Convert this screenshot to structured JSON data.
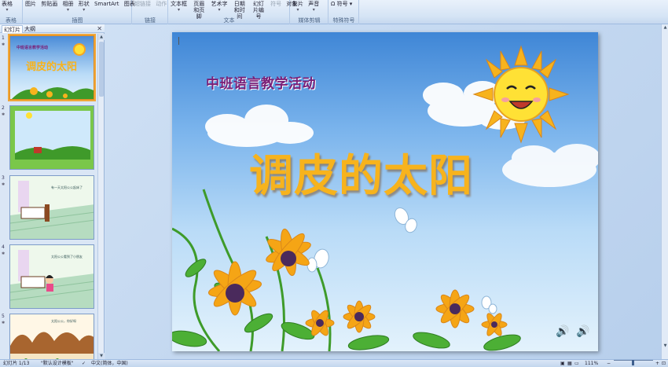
{
  "ribbon": {
    "groups": [
      {
        "id": "tables",
        "label": "表格",
        "items": [
          {
            "label": "表格",
            "disabled": false
          }
        ]
      },
      {
        "id": "illustrations",
        "label": "插图",
        "items": [
          {
            "label": "图片",
            "disabled": false
          },
          {
            "label": "剪贴画",
            "disabled": false
          },
          {
            "label": "相册",
            "disabled": false
          },
          {
            "label": "形状",
            "disabled": false
          },
          {
            "label": "SmartArt",
            "disabled": false
          },
          {
            "label": "图表",
            "disabled": false
          }
        ]
      },
      {
        "id": "links",
        "label": "链接",
        "items": [
          {
            "label": "超链接",
            "disabled": true
          },
          {
            "label": "动作",
            "disabled": true
          }
        ]
      },
      {
        "id": "text",
        "label": "文本",
        "items": [
          {
            "label": "文本框",
            "disabled": false
          },
          {
            "label": "页眉和页脚",
            "disabled": false
          },
          {
            "label": "艺术字",
            "disabled": false
          },
          {
            "label": "日期和时间",
            "disabled": false
          },
          {
            "label": "幻灯片编号",
            "disabled": false
          },
          {
            "label": "符号",
            "disabled": true
          },
          {
            "label": "对象",
            "disabled": false
          }
        ]
      },
      {
        "id": "media",
        "label": "媒体剪辑",
        "items": [
          {
            "label": "影片",
            "disabled": false
          },
          {
            "label": "声音",
            "disabled": false
          }
        ]
      },
      {
        "id": "special",
        "label": "特殊符号",
        "items": [
          {
            "label": "符号",
            "disabled": false
          }
        ]
      }
    ]
  },
  "pane": {
    "tabs": [
      "幻灯片",
      "大纲"
    ],
    "active_tab": 0,
    "close_glyph": "✕",
    "thumbnails": [
      {
        "number": "1",
        "title": "调皮的太阳",
        "subtitle": "中班语言教学活动"
      },
      {
        "number": "2"
      },
      {
        "number": "3",
        "caption": "有一天太阳公公起床了"
      },
      {
        "number": "4",
        "caption": "太阳公公看到了小朋友"
      },
      {
        "number": "5",
        "caption": "太阳公公，你好呀"
      }
    ],
    "selected_index": 0
  },
  "slide": {
    "subtitle": "中班语言教学活动",
    "title": "调皮的太阳",
    "speaker_glyph": "🔊"
  },
  "status": {
    "slide_counter": "幻灯片 1/13",
    "theme": "\"默认设计模板\"",
    "language": "中文(简体，中国)",
    "zoom": "111%",
    "zoom_level": 0.45
  },
  "colors": {
    "accent": "#f7b31d",
    "subtitle": "#7a1f77",
    "sky_top": "#3f86d6",
    "selection": "#f0a73a"
  },
  "icons": [
    "close-icon",
    "speaker-icon",
    "scroll-up-icon",
    "scroll-down-icon",
    "spell-check-icon",
    "view-normal-icon",
    "view-sorter-icon",
    "view-slideshow-icon",
    "fit-window-icon"
  ]
}
